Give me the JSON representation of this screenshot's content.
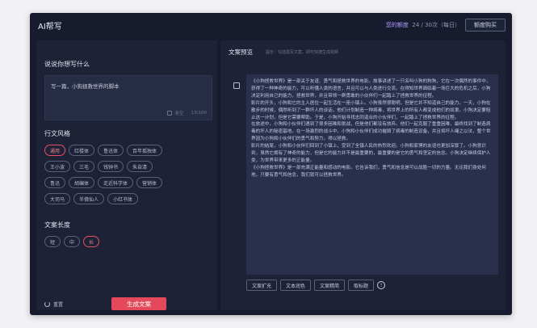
{
  "app": {
    "title": "AI帮写",
    "quota_label": "您的额度",
    "quota_value": "24 / 30次（每日）",
    "buy_label": "额度购买"
  },
  "left": {
    "prompt_label": "说说你想写什么",
    "prompt_value": "写一篇，小狗拯救世界的脚本",
    "clear_label": "清空",
    "counter": "13/100",
    "style_label": "行文风格",
    "style_rows": [
      [
        {
          "label": "通用",
          "active": true
        },
        {
          "label": "红楼体",
          "active": false
        },
        {
          "label": "鲁迅体",
          "active": false
        },
        {
          "label": "百年孤独体",
          "active": false
        }
      ],
      [
        {
          "label": "王小波",
          "active": false
        },
        {
          "label": "三毛",
          "active": false
        },
        {
          "label": "钱钟书",
          "active": false
        },
        {
          "label": "朱自清",
          "active": false
        }
      ],
      [
        {
          "label": "鲁迅",
          "active": false
        },
        {
          "label": "胡编体",
          "active": false
        },
        {
          "label": "走近科学体",
          "active": false
        },
        {
          "label": "营销体",
          "active": false
        }
      ],
      [
        {
          "label": "大司马",
          "active": false
        },
        {
          "label": "半佛仙人",
          "active": false
        },
        {
          "label": "小红书体",
          "active": false
        }
      ]
    ],
    "length_label": "文案长度",
    "length_options": [
      {
        "label": "短",
        "active": false
      },
      {
        "label": "中",
        "active": false
      },
      {
        "label": "长",
        "active": true
      }
    ],
    "reset_label": "重置",
    "generate_label": "生成文案"
  },
  "right": {
    "title": "文案预览",
    "hint": "提示：勾选需写文案，即可快捷生成视频",
    "paragraphs": [
      "《小狗拯救世界》是一部关于友谊、勇气和拯救世界的电影。故事讲述了一只名叫小狗的狗狗，它在一次偶然的事件中，获得了一种神奇的能力，可以听懂人类的语言，并且可以与人类进行交流。在得知世界面临着一场巨大的危机之后，小狗决定利用自己的能力，拯救世界，并且带领一群勇敢的小伙伴们一起踏上了拯救世界的征程。",
      "影片的开头，小狗和它的主人居住一起生活在一座小镇上。小狗虽然很聪明，但是它并不知道自己的能力。一天，小狗在散步的时候，偶然听到了一群坏人的谈话，他们计划制造一种病毒，将世界上的所有人都变成他们的奴隶。小狗决定要阻止这一计划，但是它需要帮助。于是，小狗开始寻找志同道合的小伙伴们，一起踏上了拯救世界的征程。",
      "在旅途中，小狗和小伙伴们遇到了很多困难和挑战，但是他们都没有放弃。他们一起克服了重重困难，最终找到了制造病毒的坏人的秘密基地。在一场激烈的战斗中，小狗和小伙伴们成功摧毁了病毒的制造设备，并且将坏人绳之以法，整个世界因为小狗和小伙伴们的勇气和努力，得以拯救。",
      "影片的结尾，小狗和小伙伴们回到了小镇上，受到了全镇人民的热烈欢迎。小狗和家博的友谊也更加深厚了。小狗意识到，虽然它拥有了神奇的能力，但是它的能力并不是最重要的，最重要的是它的勇气和坚定的信念。小狗决定继续保护人类，为世界带来更多的正能量。",
      "《小狗拯救世界》是一部充满正能量和感动的电影。它告诉我们，勇气和信念是可以战胜一切的力量。无论我们身处何地，只要有勇气和信念，我们就可以拯救世界。"
    ],
    "actions": [
      "文案扩充",
      "文本润色",
      "文案精简",
      "取标题"
    ],
    "info_icon": "!"
  }
}
